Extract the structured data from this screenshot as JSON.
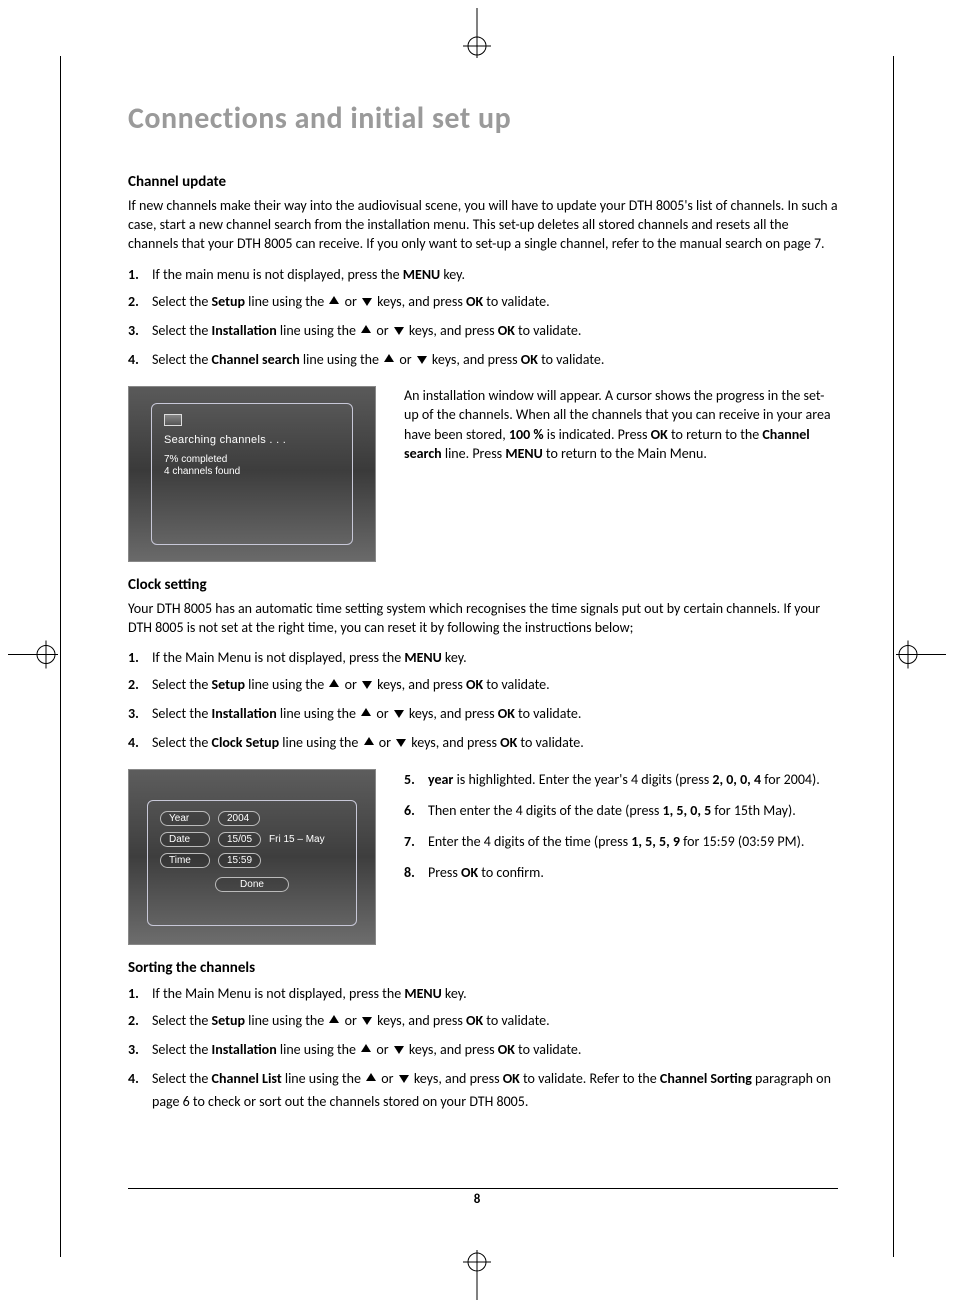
{
  "page_number": "8",
  "title": "Connections and initial set up",
  "section_channel_update": {
    "heading": "Channel update",
    "intro": "If new channels make their way into the audiovisual scene, you will have to update your DTH 8005's list of channels. In such a case, start a new channel search from the installation menu. This set-up deletes all stored channels and resets all the channels that your DTH 8005 can receive. If you only want to set-up a single channel, refer to the manual search on page 7.",
    "steps": [
      {
        "n": "1.",
        "pre": "If the main menu is not displayed, press the ",
        "b1": "MENU",
        "post": " key."
      },
      {
        "n": "2.",
        "pre": "Select the ",
        "b1": "Setup",
        "mid": " line using the ",
        "arrows": true,
        "post2": " keys, and press ",
        "b2": "OK",
        "post3": " to validate."
      },
      {
        "n": "3.",
        "pre": "Select the ",
        "b1": "Installation",
        "mid": " line using the ",
        "arrows": true,
        "post2": " keys, and press ",
        "b2": "OK",
        "post3": " to validate."
      },
      {
        "n": "4.",
        "pre": "Select the ",
        "b1": "Channel search",
        "mid": " line using the ",
        "arrows": true,
        "post2": " keys, and press ",
        "b2": "OK",
        "post3": " to validate."
      }
    ],
    "fig": {
      "line1": "Searching channels . . .",
      "line2": "7% completed",
      "line3": "4 channels found"
    },
    "fig_caption_parts": {
      "p1": "An installation window will appear. A cursor shows the progress in the set-up of the channels. When all the channels that you can receive in your area have been stored, ",
      "b1": "100 %",
      "p2": " is indicated. Press ",
      "b2": "OK",
      "p3": " to return to the ",
      "b3": "Channel search",
      "p4": " line. Press ",
      "b4": "MENU",
      "p5": " to return to the Main Menu."
    }
  },
  "section_clock": {
    "heading": "Clock setting",
    "intro": "Your DTH 8005 has an automatic time setting system which recognises the time signals put out by certain channels. If your DTH 8005 is not set at the right time, you can reset it by following the instructions below;",
    "steps": [
      {
        "n": "1.",
        "pre": "If the Main Menu is not displayed, press the ",
        "b1": "MENU",
        "post": " key."
      },
      {
        "n": "2.",
        "pre": "Select the ",
        "b1": "Setup",
        "mid": " line using the ",
        "arrows": true,
        "post2": " keys, and press ",
        "b2": "OK",
        "post3": " to validate."
      },
      {
        "n": "3.",
        "pre": "Select the ",
        "b1": "Installation",
        "mid": " line using the ",
        "arrows": true,
        "post2": " keys, and press ",
        "b2": "OK",
        "post3": " to validate."
      },
      {
        "n": "4.",
        "pre": "Select the ",
        "b1": "Clock Setup",
        "mid": " line using the ",
        "arrows": true,
        "post2": " keys, and press ",
        "b2": "OK",
        "post3": " to validate."
      }
    ],
    "fig": {
      "year_label": "Year",
      "year_val": "2004",
      "date_label": "Date",
      "date_val": "15/05",
      "date_extra": "Fri   15 – May",
      "time_label": "Time",
      "time_val": "15:59",
      "done": "Done"
    },
    "side_steps": [
      {
        "n": "5.",
        "b1": "year",
        "p1": " is highlighted. Enter the year's 4 digits (press ",
        "d": "2, 0, 0, 4",
        "p2": " for 2004)."
      },
      {
        "n": "6.",
        "p0": "Then enter the 4 digits of the date (press ",
        "d": "1, 5, 0, 5",
        "p2": " for 15th May)."
      },
      {
        "n": "7.",
        "p0": "Enter the 4 digits of the time (press ",
        "d": "1, 5, 5, 9",
        "p2": " for 15:59 (03:59 PM)."
      },
      {
        "n": "8.",
        "p0": "Press ",
        "b1": "OK",
        "p2": " to confirm."
      }
    ]
  },
  "section_sorting": {
    "heading": "Sorting the channels",
    "steps": [
      {
        "n": "1.",
        "pre": "If the Main Menu is not displayed, press the ",
        "b1": "MENU",
        "post": " key."
      },
      {
        "n": "2.",
        "pre": "Select the ",
        "b1": "Setup",
        "mid": " line using the ",
        "arrows": true,
        "post2": " keys, and press ",
        "b2": "OK",
        "post3": " to validate."
      },
      {
        "n": "3.",
        "pre": "Select the ",
        "b1": "Installation",
        "mid": " line using the ",
        "arrows": true,
        "post2": " keys, and press ",
        "b2": "OK",
        "post3": " to validate."
      },
      {
        "n": "4.",
        "pre": "Select the ",
        "b1": "Channel List",
        "mid": " line using the ",
        "arrows": true,
        "post2": " keys, and press ",
        "b2": "OK",
        "post3": " to validate. Refer to the ",
        "b3": "Channel Sorting",
        "post4": " paragraph on page 6 to check or sort out the channels stored on your DTH 8005."
      }
    ]
  }
}
